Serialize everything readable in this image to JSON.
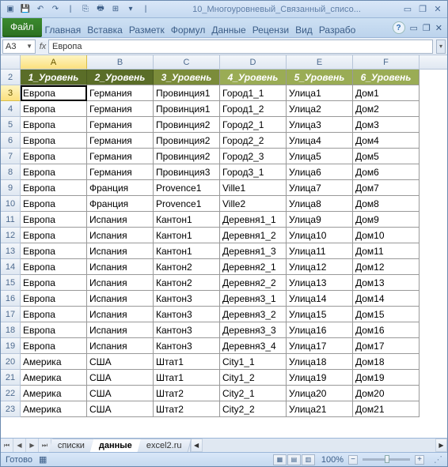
{
  "title": "10_Многоуровневый_Связанный_списо...",
  "ribbon_tabs": [
    "Главная",
    "Вставка",
    "Разметк",
    "Формул",
    "Данные",
    "Рецензи",
    "Вид",
    "Разрабо"
  ],
  "file_tab": "Файл",
  "namebox": "A3",
  "formula": "Европа",
  "columns": [
    "A",
    "B",
    "C",
    "D",
    "E",
    "F"
  ],
  "header_row": {
    "num": "2",
    "cells": [
      "1_Уровень",
      "2_Уровень",
      "3_Уровень",
      "4_Уровень",
      "5_Уровень",
      "6_Уровень"
    ]
  },
  "chart_data": {
    "type": "table",
    "columns": [
      "1_Уровень",
      "2_Уровень",
      "3_Уровень",
      "4_Уровень",
      "5_Уровень",
      "6_Уровень"
    ],
    "rows": [
      [
        "Европа",
        "Германия",
        "Провинция1",
        "Город1_1",
        "Улица1",
        "Дом1"
      ],
      [
        "Европа",
        "Германия",
        "Провинция1",
        "Город1_2",
        "Улица2",
        "Дом2"
      ],
      [
        "Европа",
        "Германия",
        "Провинция2",
        "Город2_1",
        "Улица3",
        "Дом3"
      ],
      [
        "Европа",
        "Германия",
        "Провинция2",
        "Город2_2",
        "Улица4",
        "Дом4"
      ],
      [
        "Европа",
        "Германия",
        "Провинция2",
        "Город2_3",
        "Улица5",
        "Дом5"
      ],
      [
        "Европа",
        "Германия",
        "Провинция3",
        "Город3_1",
        "Улица6",
        "Дом6"
      ],
      [
        "Европа",
        "Франция",
        "Provence1",
        "Ville1",
        "Улица7",
        "Дом7"
      ],
      [
        "Европа",
        "Франция",
        "Provence1",
        "Ville2",
        "Улица8",
        "Дом8"
      ],
      [
        "Европа",
        "Испания",
        "Кантон1",
        "Деревня1_1",
        "Улица9",
        "Дом9"
      ],
      [
        "Европа",
        "Испания",
        "Кантон1",
        "Деревня1_2",
        "Улица10",
        "Дом10"
      ],
      [
        "Европа",
        "Испания",
        "Кантон1",
        "Деревня1_3",
        "Улица11",
        "Дом11"
      ],
      [
        "Европа",
        "Испания",
        "Кантон2",
        "Деревня2_1",
        "Улица12",
        "Дом12"
      ],
      [
        "Европа",
        "Испания",
        "Кантон2",
        "Деревня2_2",
        "Улица13",
        "Дом13"
      ],
      [
        "Европа",
        "Испания",
        "Кантон3",
        "Деревня3_1",
        "Улица14",
        "Дом14"
      ],
      [
        "Европа",
        "Испания",
        "Кантон3",
        "Деревня3_2",
        "Улица15",
        "Дом15"
      ],
      [
        "Европа",
        "Испания",
        "Кантон3",
        "Деревня3_3",
        "Улица16",
        "Дом16"
      ],
      [
        "Европа",
        "Испания",
        "Кантон3",
        "Деревня3_4",
        "Улица17",
        "Дом17"
      ],
      [
        "Америка",
        "США",
        "Штат1",
        "City1_1",
        "Улица18",
        "Дом18"
      ],
      [
        "Америка",
        "США",
        "Штат1",
        "City1_2",
        "Улица19",
        "Дом19"
      ],
      [
        "Америка",
        "США",
        "Штат2",
        "City2_1",
        "Улица20",
        "Дом20"
      ],
      [
        "Америка",
        "США",
        "Штат2",
        "City2_2",
        "Улица21",
        "Дом21"
      ]
    ]
  },
  "first_data_row": 3,
  "sheet_tabs": [
    "списки",
    "данные",
    "excel2.ru"
  ],
  "active_sheet": 1,
  "status_text": "Готово",
  "zoom": "100%"
}
